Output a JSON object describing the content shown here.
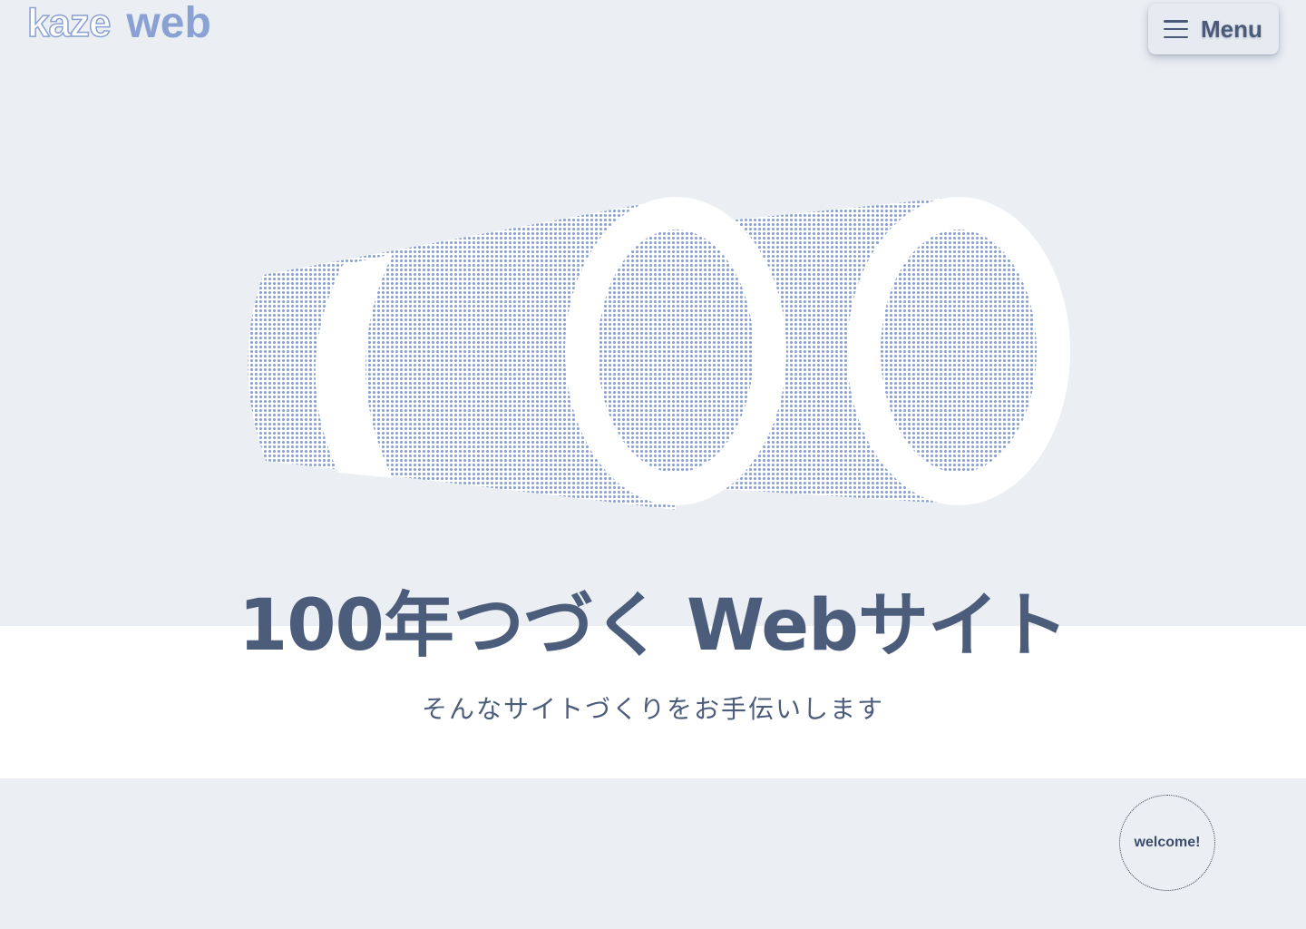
{
  "header": {
    "logo_kaze": "kaze",
    "logo_web": "web",
    "menu_label": "Menu"
  },
  "hero": {
    "illustration_icon": "binoculars-icon",
    "title": "100年つづく Webサイト",
    "subtitle": "そんなサイトづくりをお手伝いします"
  },
  "badge": {
    "label": "welcome!"
  },
  "colors": {
    "background": "#ebeff3",
    "accent_blue": "#8aa1d3",
    "text_navy": "#4c5c7b",
    "band_white": "#ffffff"
  }
}
